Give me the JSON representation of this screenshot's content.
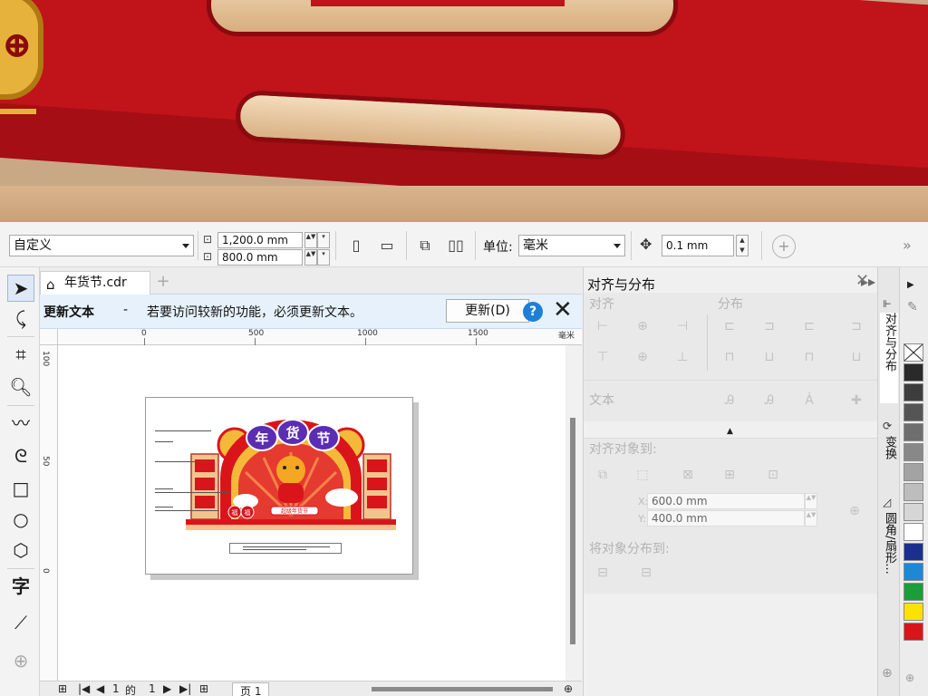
{
  "property_bar": {
    "paper_preset": "自定义",
    "width_value": "1,200.0 mm",
    "height_value": "800.0 mm",
    "units_label": "单位:",
    "units_value": "毫米",
    "nudge_value": "0.1 mm",
    "more_glyph": "»"
  },
  "document": {
    "tab_title": "年货节.cdr",
    "new_tab_glyph": "+"
  },
  "notification": {
    "title": "更新文本",
    "dash": "-",
    "message": "若要访问较新的功能，必须更新文本。",
    "button_label": "更新(D)",
    "help_glyph": "?"
  },
  "ruler": {
    "unit": "毫米",
    "h_ticks": [
      "0",
      "500",
      "1000",
      "1500"
    ],
    "v_ticks": [
      "100",
      "50",
      "0"
    ]
  },
  "booth_art": {
    "sign_chars": [
      "年",
      "货",
      "节"
    ],
    "banner_text": "超级年货节",
    "fu_char": "福"
  },
  "page_nav": {
    "current": "1",
    "of_label": "的",
    "total": "1",
    "page_tab": "页 1"
  },
  "docker": {
    "title": "对齐与分布",
    "align_label": "对齐",
    "distribute_label": "分布",
    "text_label": "文本",
    "align_to_label": "对齐对象到:",
    "x_label": "X:",
    "x_value": "600.0 mm",
    "y_label": "Y:",
    "y_value": "400.0 mm",
    "distribute_to_label": "将对象分布到:"
  },
  "vertical_tabs": [
    "对齐与分布",
    "变换",
    "圆角/扇形..."
  ],
  "palette_colors": [
    "#2a2a2a",
    "#3d3d3d",
    "#555555",
    "#6e6e6e",
    "#888888",
    "#a3a3a3",
    "#bdbdbd",
    "#d6d6d6",
    "#ffffff",
    "#1b2f8f",
    "#1c88d6",
    "#1a9e3a",
    "#ffe100",
    "#d9151b"
  ]
}
